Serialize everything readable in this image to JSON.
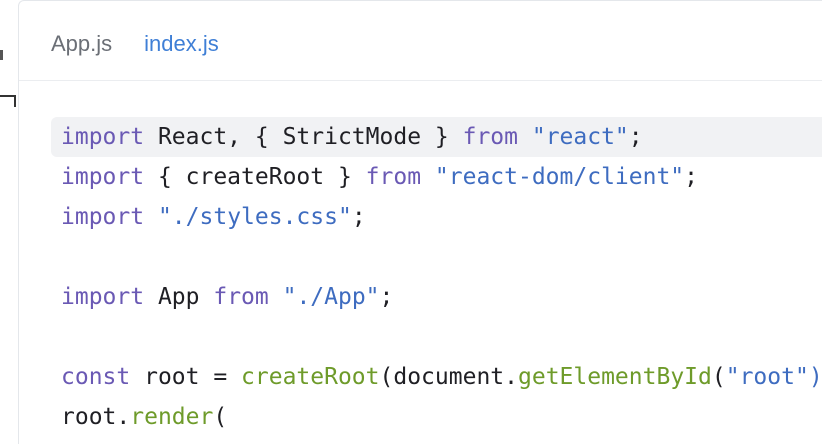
{
  "tabs": [
    {
      "label": "App.js",
      "active": false
    },
    {
      "label": "index.js",
      "active": true
    }
  ],
  "code": {
    "lines": [
      [
        {
          "t": "kw",
          "v": "import"
        },
        {
          "t": "tx",
          "v": " React, { StrictMode } "
        },
        {
          "t": "kw",
          "v": "from"
        },
        {
          "t": "tx",
          "v": " "
        },
        {
          "t": "str",
          "v": "\"react\""
        },
        {
          "t": "tx",
          "v": ";"
        }
      ],
      [
        {
          "t": "kw",
          "v": "import"
        },
        {
          "t": "tx",
          "v": " { createRoot } "
        },
        {
          "t": "kw",
          "v": "from"
        },
        {
          "t": "tx",
          "v": " "
        },
        {
          "t": "str",
          "v": "\"react-dom/client\""
        },
        {
          "t": "tx",
          "v": ";"
        }
      ],
      [
        {
          "t": "kw",
          "v": "import"
        },
        {
          "t": "tx",
          "v": " "
        },
        {
          "t": "str",
          "v": "\"./styles.css\""
        },
        {
          "t": "tx",
          "v": ";"
        }
      ],
      [],
      [
        {
          "t": "kw",
          "v": "import"
        },
        {
          "t": "tx",
          "v": " App "
        },
        {
          "t": "kw",
          "v": "from"
        },
        {
          "t": "tx",
          "v": " "
        },
        {
          "t": "str",
          "v": "\"./App\""
        },
        {
          "t": "tx",
          "v": ";"
        }
      ],
      [],
      [
        {
          "t": "kw",
          "v": "const"
        },
        {
          "t": "tx",
          "v": " root = "
        },
        {
          "t": "fn",
          "v": "createRoot"
        },
        {
          "t": "tx",
          "v": "(document."
        },
        {
          "t": "fn",
          "v": "getElementById"
        },
        {
          "t": "tx",
          "v": "("
        },
        {
          "t": "str",
          "v": "\"root\")"
        }
      ],
      [
        {
          "t": "tx",
          "v": "root."
        },
        {
          "t": "fn",
          "v": "render"
        },
        {
          "t": "tx",
          "v": "("
        }
      ]
    ],
    "highlighted_line": 0
  },
  "colors": {
    "keyword": "#6a59b4",
    "string": "#3e6cc0",
    "function": "#6e9b2a",
    "active_tab": "#3f7fd6"
  }
}
